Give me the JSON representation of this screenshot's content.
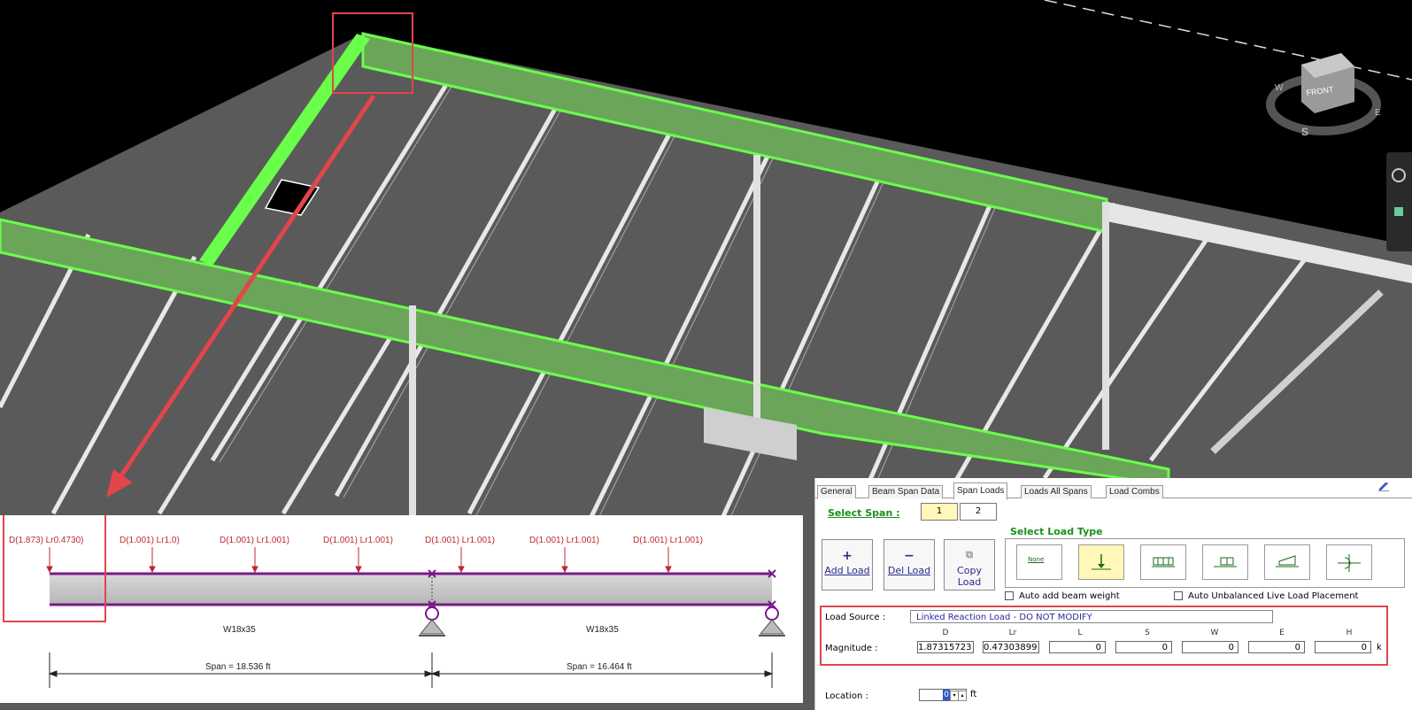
{
  "viewcube": {
    "face": "FRONT",
    "compass": {
      "w": "W",
      "e": "E",
      "s": "S"
    },
    "navbar_icons": [
      "orbit-icon",
      "model-icon"
    ]
  },
  "diagram": {
    "load_labels": [
      "D(1.873) Lr0.4730)",
      "D(1.001) Lr1.0)",
      "D(1.001) Lr1.001)",
      "D(1.001) Lr1.001)",
      "D(1.001) Lr1.001)",
      "D(1.001) Lr1.001)",
      "D(1.001) Lr1.001)"
    ],
    "beam_labels": [
      "W18x35",
      "W18x35"
    ],
    "span_labels": [
      "Span = 18.536 ft",
      "Span = 16.464 ft"
    ]
  },
  "dialog": {
    "tabs": [
      {
        "label": "General"
      },
      {
        "label": "Beam Span Data"
      },
      {
        "label": "Span Loads",
        "active": true
      },
      {
        "label": "Loads All Spans"
      },
      {
        "label": "Load Combs"
      }
    ],
    "select_span_label": "Select Span :",
    "span_buttons": [
      "1",
      "2"
    ],
    "add_load": "Add Load",
    "del_load": "Del Load",
    "copy_load": "Copy Load",
    "select_load_type_label": "Select Load Type",
    "load_type_none": "None",
    "auto_beam_weight": "Auto add beam weight",
    "auto_unbalanced": "Auto Unbalanced Live Load Placement",
    "load_source_label": "Load Source :",
    "load_source_value": "Linked Reaction Load - DO NOT MODIFY",
    "magnitude_label": "Magnitude :",
    "columns": [
      "D",
      "Lr",
      "L",
      "S",
      "W",
      "E",
      "H"
    ],
    "magnitudes": [
      "1.87315723",
      "0.47303899",
      "0",
      "0",
      "0",
      "0",
      "0"
    ],
    "unit": "k",
    "location_label": "Location :",
    "location_value": "0",
    "location_unit": "ft"
  },
  "colors": {
    "highlight_beam": "#6aff4a",
    "annotation_red": "#e2454a",
    "label_red": "#c0282f",
    "beam_purple": "#7a1a8a"
  }
}
